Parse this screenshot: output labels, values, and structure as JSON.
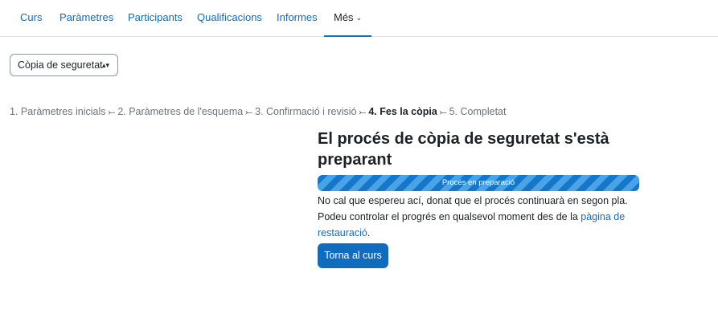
{
  "nav": {
    "tabs": [
      {
        "label": "Curs"
      },
      {
        "label": "Paràmetres"
      },
      {
        "label": "Participants"
      },
      {
        "label": "Qualificacions"
      },
      {
        "label": "Informes"
      },
      {
        "label": "Més"
      }
    ],
    "active_tab": "Més"
  },
  "select": {
    "value": "Còpia de seguretat"
  },
  "steps": {
    "items": [
      "1. Paràmetres inicials",
      "2. Paràmetres de l'esquema",
      "3. Confirmació i revisió",
      "4. Fes la còpia",
      "5. Completat"
    ],
    "current_index": 3,
    "separator": "⤚"
  },
  "main": {
    "heading": "El procés de còpia de seguretat s'està preparant",
    "progress_label": "Procés en preparació",
    "progress_value": 1.0,
    "message_text": "No cal que espereu ací, donat que el procés continuarà en segon pla. Podeu controlar el progrés en qualsevol moment des de la ",
    "message_link": "pàgina de restauració",
    "message_end": ".",
    "button_label": "Torna al curs"
  },
  "colors": {
    "accent": "#0f6cbf",
    "progress_stripe_dark": "#1477c9",
    "progress_stripe_light": "#4aa3e6"
  }
}
